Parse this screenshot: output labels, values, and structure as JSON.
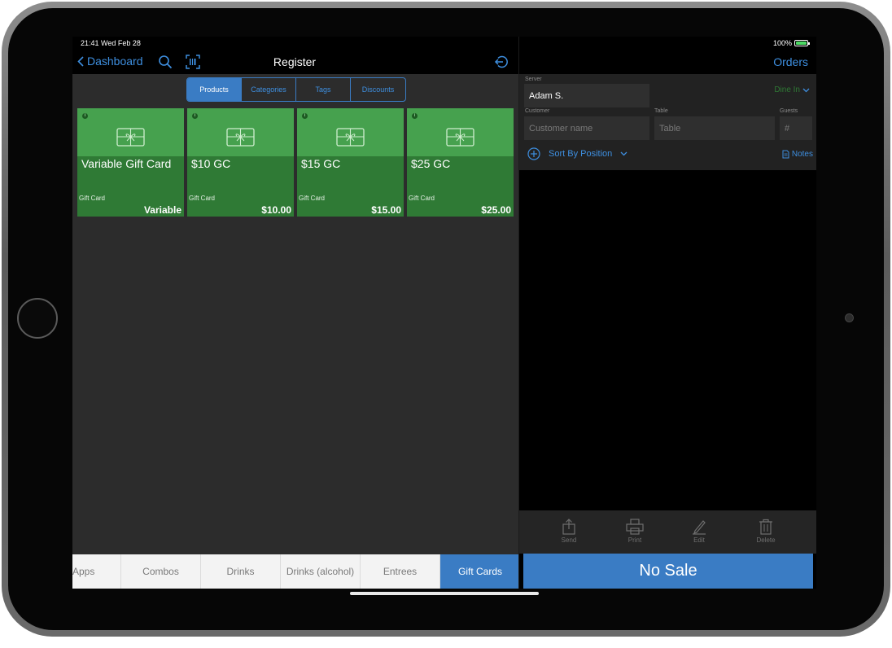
{
  "status_bar": {
    "time": "21:41  Wed Feb 28",
    "battery": "100%"
  },
  "nav": {
    "back_label": "Dashboard",
    "title": "Register",
    "orders_label": "Orders"
  },
  "segments": [
    "Products",
    "Categories",
    "Tags",
    "Discounts"
  ],
  "products": [
    {
      "name": "Variable Gift Card",
      "category": "Gift Card",
      "price": "Variable"
    },
    {
      "name": "$10 GC",
      "category": "Gift Card",
      "price": "$10.00"
    },
    {
      "name": "$15 GC",
      "category": "Gift Card",
      "price": "$15.00"
    },
    {
      "name": "$25 GC",
      "category": "Gift Card",
      "price": "$25.00"
    }
  ],
  "order_form": {
    "server_label": "Server",
    "server_value": "Adam S.",
    "dine_in": "Dine In",
    "customer_label": "Customer",
    "customer_placeholder": "Customer name",
    "table_label": "Table",
    "table_placeholder": "Table",
    "guests_label": "Guests",
    "guests_placeholder": "#",
    "sort_label": "Sort By Position",
    "notes_label": "Notes"
  },
  "actions": [
    "Send",
    "Print",
    "Edit",
    "Delete"
  ],
  "no_sale_label": "No Sale",
  "category_tabs": [
    "Apps",
    "Combos",
    "Drinks",
    "Drinks (alcohol)",
    "Entrees",
    "Gift Cards"
  ],
  "colors": {
    "accent": "#3a7cc4",
    "card_top": "#46a14e",
    "card_bottom": "#2f7a35",
    "link": "#3e8fe0"
  },
  "icons": [
    "chevron-left-icon",
    "search-icon",
    "barcode-scan-icon",
    "logout-icon",
    "gift-card-icon",
    "chevron-down-icon",
    "plus-circle-icon",
    "notes-icon",
    "send-icon",
    "print-icon",
    "edit-icon",
    "delete-icon"
  ]
}
